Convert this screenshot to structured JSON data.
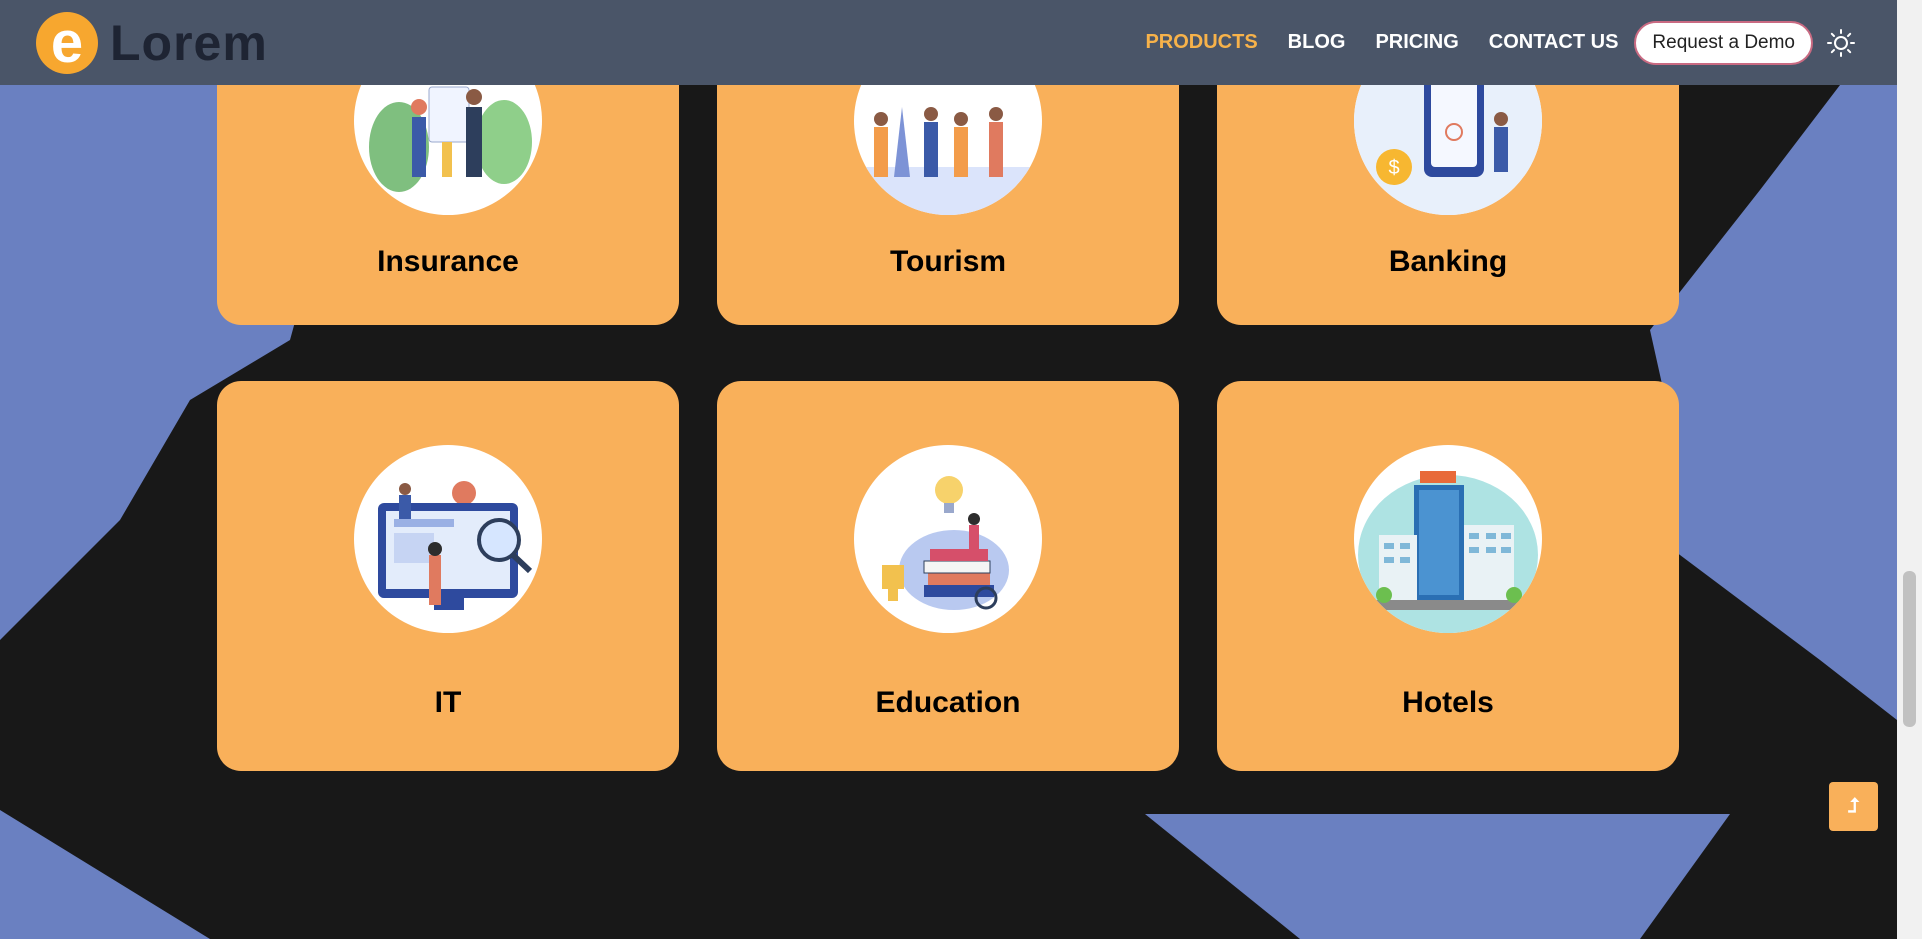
{
  "brand": {
    "name": "Lorem",
    "mark": "e"
  },
  "nav": {
    "links": [
      {
        "label": "PRODUCTS",
        "active": true
      },
      {
        "label": "BLOG",
        "active": false
      },
      {
        "label": "PRICING",
        "active": false
      },
      {
        "label": "CONTACT US",
        "active": false
      }
    ],
    "demo_button": "Request a Demo",
    "theme_icon": "sun-icon"
  },
  "cards": [
    {
      "label": "Insurance",
      "icon": "insurance-illustration"
    },
    {
      "label": "Tourism",
      "icon": "tourism-illustration"
    },
    {
      "label": "Banking",
      "icon": "banking-illustration"
    },
    {
      "label": "IT",
      "icon": "it-illustration"
    },
    {
      "label": "Education",
      "icon": "education-illustration"
    },
    {
      "label": "Hotels",
      "icon": "hotels-illustration"
    }
  ],
  "scroll_top": {
    "icon": "arrow-up-icon",
    "glyph": "⮥"
  },
  "colors": {
    "navbar": "#4a5568",
    "accent": "#f9b05a",
    "active_link": "#f7b24a",
    "background_dark": "#181818",
    "background_shape": "#6a80c1"
  }
}
